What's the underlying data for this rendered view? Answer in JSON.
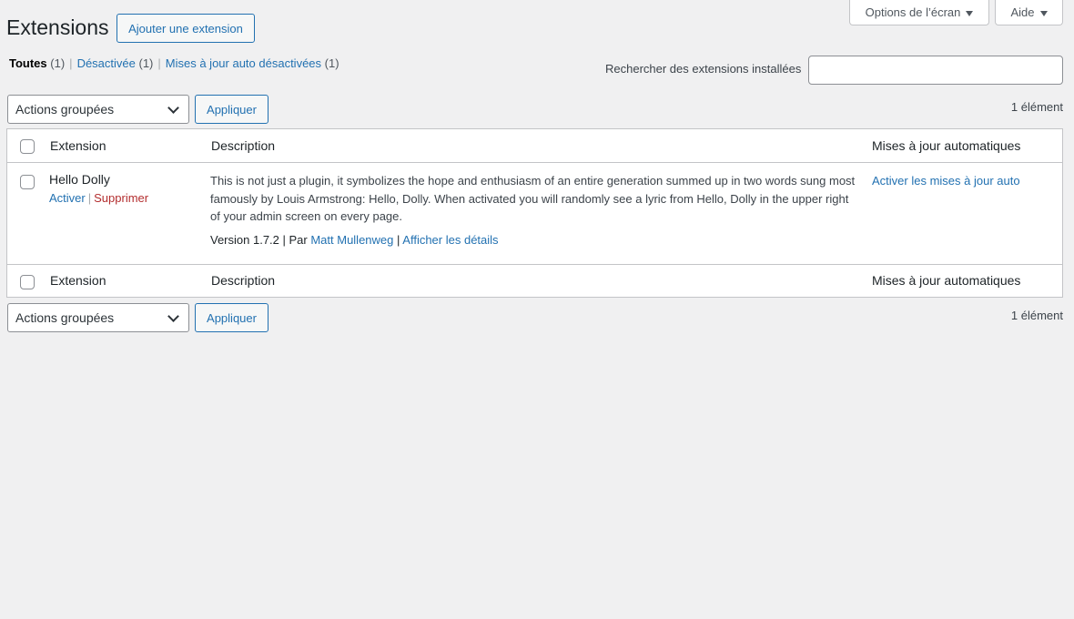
{
  "screen_meta": {
    "options_label": "Options de l’écran",
    "help_label": "Aide"
  },
  "header": {
    "title": "Extensions",
    "add_button": "Ajouter une extension"
  },
  "filters": [
    {
      "label": "Toutes",
      "count": "(1)",
      "current": true
    },
    {
      "label": "Désactivée",
      "count": "(1)",
      "current": false
    },
    {
      "label": "Mises à jour auto désactivées",
      "count": "(1)",
      "current": false
    }
  ],
  "search": {
    "label": "Rechercher des extensions installées",
    "value": "",
    "placeholder": ""
  },
  "bulk": {
    "select_value": "Actions groupées",
    "apply_label": "Appliquer",
    "count": "1 élément"
  },
  "table": {
    "columns": [
      "Extension",
      "Description",
      "Mises à jour automatiques"
    ],
    "rows": [
      {
        "name": "Hello Dolly",
        "action_activate": "Activer",
        "action_delete": "Supprimer",
        "description": "This is not just a plugin, it symbolizes the hope and enthusiasm of an entire generation summed up in two words sung most famously by Louis Armstrong: Hello, Dolly. When activated you will randomly see a lyric from Hello, Dolly in the upper right of your admin screen on every page.",
        "version_text": "Version 1.7.2 | Par",
        "author": "Matt Mullenweg",
        "details_link": "Afficher les détails",
        "auto_update_link": "Activer les mises à jour auto"
      }
    ]
  },
  "colors": {
    "background": "#f0f0f1",
    "link": "#2271b1",
    "delete": "#b32d2e",
    "text": "#1d2327"
  }
}
